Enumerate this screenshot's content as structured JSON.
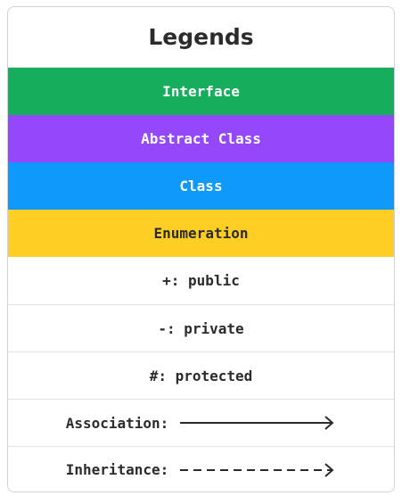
{
  "legend": {
    "title": "Legends",
    "colors": {
      "interface": "#16ad5c",
      "abstract_class": "#9547fc",
      "class": "#0f99fa",
      "enumeration": "#fece24",
      "enumeration_text": "#2b2b2b"
    },
    "kinds": {
      "interface": "Interface",
      "abstract_class": "Abstract Class",
      "class": "Class",
      "enumeration": "Enumeration"
    },
    "visibility": {
      "public": "+: public",
      "private": "-: private",
      "protected": "#: protected"
    },
    "relations": {
      "association": {
        "label": "Association:",
        "icon": "solid-arrow-icon"
      },
      "inheritance": {
        "label": "Inheritance:",
        "icon": "dashed-arrow-icon"
      }
    }
  }
}
